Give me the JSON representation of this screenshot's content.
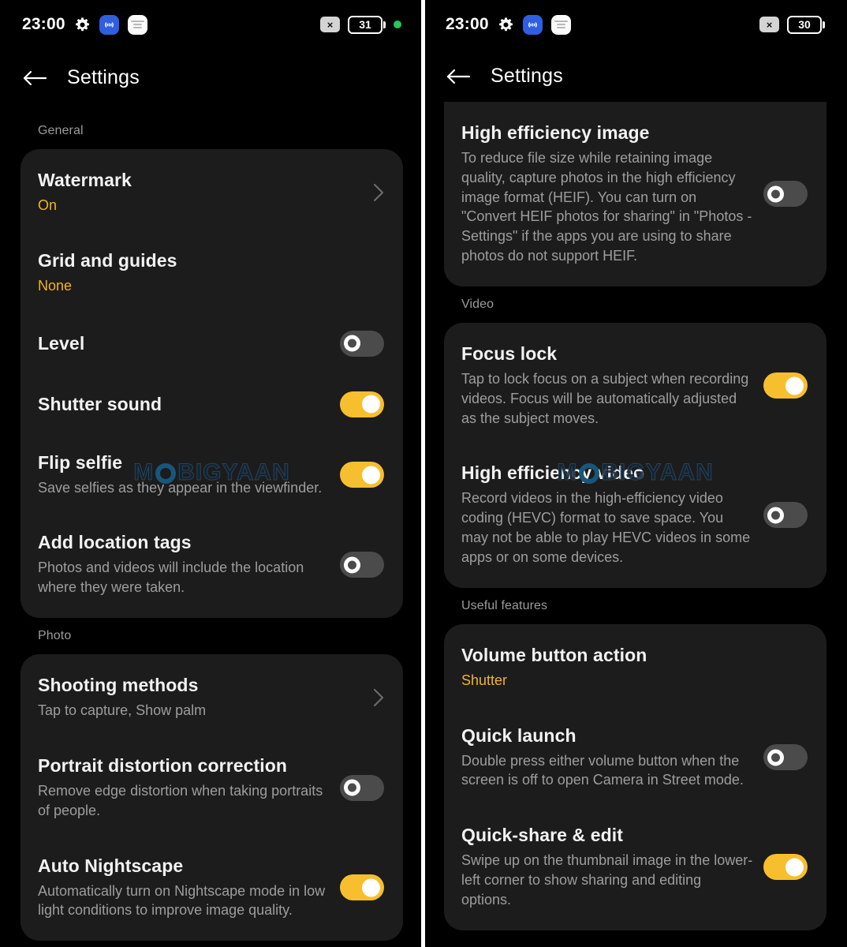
{
  "accent_color": "#f7bf2e",
  "card_color": "#1c1c1c",
  "background_color": "#000000",
  "watermark": {
    "before": "M",
    "after": "BIGYAAN"
  },
  "left_panel": {
    "status_bar": {
      "time": "23:00",
      "gear_icon": "gear-icon",
      "broadcast_icon": "broadcast-icon",
      "notification_icon": "notification-card-icon",
      "x_badge": "×",
      "battery_level": "31",
      "privacy_dot": "green-dot"
    },
    "app_bar": {
      "back_label": "back-arrow",
      "title": "Settings"
    },
    "sections": [
      {
        "label": "General",
        "rows": [
          {
            "title": "Watermark",
            "subtitle": "On",
            "subtitle_accent": true,
            "control": "chevron"
          },
          {
            "title": "Grid and guides",
            "subtitle": "None",
            "subtitle_accent": true,
            "control": "none"
          },
          {
            "title": "Level",
            "subtitle": "",
            "control": "toggle",
            "toggle_on": false
          },
          {
            "title": "Shutter sound",
            "subtitle": "",
            "control": "toggle",
            "toggle_on": true
          },
          {
            "title": "Flip selfie",
            "subtitle": "Save selfies as they appear in the viewfinder.",
            "control": "toggle",
            "toggle_on": true
          },
          {
            "title": "Add location tags",
            "subtitle": "Photos and videos will include the location where they were taken.",
            "control": "toggle",
            "toggle_on": false
          }
        ]
      },
      {
        "label": "Photo",
        "rows": [
          {
            "title": "Shooting methods",
            "subtitle": "Tap to capture, Show palm",
            "control": "chevron"
          },
          {
            "title": "Portrait distortion correction",
            "subtitle": "Remove edge distortion when taking portraits of people.",
            "control": "toggle",
            "toggle_on": false
          },
          {
            "title": "Auto Nightscape",
            "subtitle": "Automatically turn on Nightscape mode in low light conditions to improve image quality.",
            "control": "toggle",
            "toggle_on": true
          }
        ]
      }
    ]
  },
  "right_panel": {
    "status_bar": {
      "time": "23:00",
      "gear_icon": "gear-icon",
      "broadcast_icon": "broadcast-icon",
      "notification_icon": "notification-card-icon",
      "x_badge": "×",
      "battery_level": "30"
    },
    "app_bar": {
      "back_label": "back-arrow",
      "title": "Settings"
    },
    "sections": [
      {
        "label": "",
        "clipped": true,
        "rows": [
          {
            "title": "High efficiency image",
            "subtitle": "To reduce file size while retaining image quality, capture photos in the high efficiency image format (HEIF). You can turn on \"Convert HEIF photos for sharing\" in \"Photos - Settings\" if the apps you are using to share photos do not support HEIF.",
            "control": "toggle",
            "toggle_on": false
          }
        ]
      },
      {
        "label": "Video",
        "rows": [
          {
            "title": "Focus lock",
            "subtitle": "Tap to lock focus on a subject when recording videos. Focus will be automatically adjusted as the subject moves.",
            "control": "toggle",
            "toggle_on": true
          },
          {
            "title": "High efficiency video",
            "subtitle": "Record videos in the high-efficiency video coding (HEVC) format to save space. You may not be able to play HEVC videos in some apps or on some devices.",
            "control": "toggle",
            "toggle_on": false
          }
        ]
      },
      {
        "label": "Useful features",
        "rows": [
          {
            "title": "Volume button action",
            "subtitle": "Shutter",
            "subtitle_accent": true,
            "control": "none"
          },
          {
            "title": "Quick launch",
            "subtitle": "Double press either volume button when the screen is off to open Camera in Street mode.",
            "control": "toggle",
            "toggle_on": false
          },
          {
            "title": "Quick-share & edit",
            "subtitle": "Swipe up on the thumbnail image in the lower-left corner to show sharing and editing options.",
            "control": "toggle",
            "toggle_on": true
          }
        ]
      }
    ]
  }
}
